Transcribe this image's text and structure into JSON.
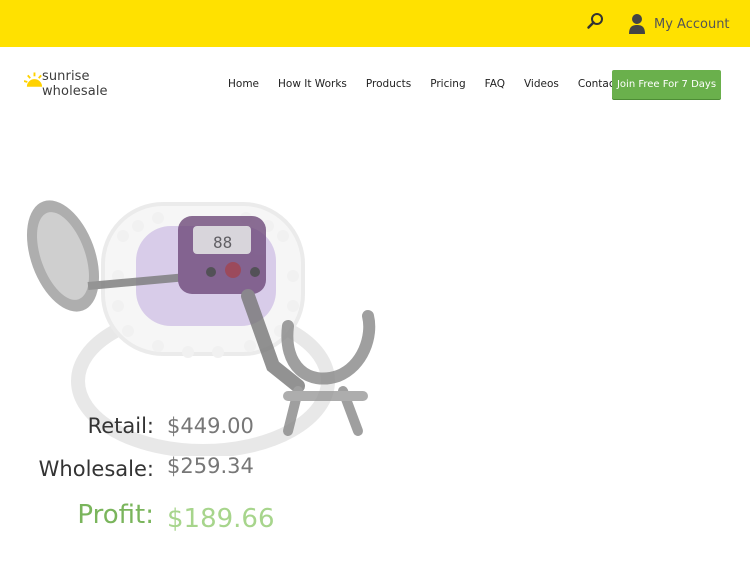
{
  "header": {
    "account_label": "My Account"
  },
  "logo": {
    "text": "sunrise wholesale"
  },
  "nav": {
    "items": [
      "Home",
      "How It Works",
      "Products",
      "Pricing",
      "FAQ",
      "Videos",
      "Contact Us"
    ],
    "cta_label": "Join Free For 7 Days"
  },
  "pricing": {
    "retail_label": "Retail:",
    "retail_value": "$449.00",
    "wholesale_label": "Wholesale:",
    "wholesale_value": "$259.34",
    "profit_label": "Profit:",
    "profit_value": "$189.66"
  },
  "colors": {
    "topbar": "#ffe100",
    "cta": "#6ab04c",
    "profit": "#7ab55c"
  },
  "icons": [
    "search-icon",
    "user-icon",
    "sun-logo-icon"
  ]
}
